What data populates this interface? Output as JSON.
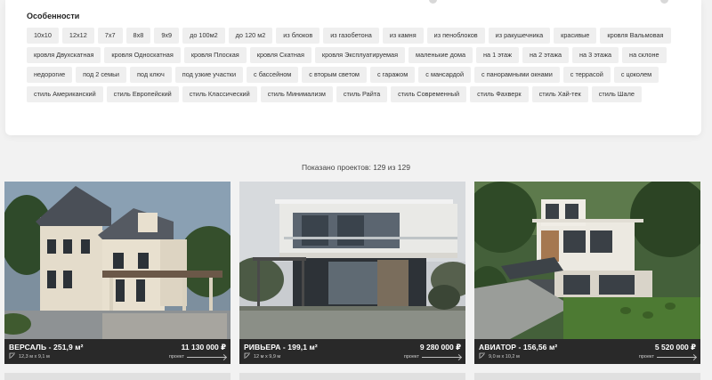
{
  "filters": {
    "title": "Особенности",
    "tags": [
      "10x10",
      "12x12",
      "7x7",
      "8x8",
      "9x9",
      "до 100м2",
      "до 120 м2",
      "из блоков",
      "из газобетона",
      "из камня",
      "из пеноблоков",
      "из ракушечника",
      "красивые",
      "кровля Вальмовая",
      "кровля Двухскатная",
      "кровля Односкатная",
      "кровля Плоская",
      "кровля Скатная",
      "кровля Эксплуатируемая",
      "маленькие дома",
      "на 1 этаж",
      "на 2 этажа",
      "на 3 этажа",
      "на склоне",
      "недорогие",
      "под 2 семьи",
      "под ключ",
      "под узкие участки",
      "с бассейном",
      "с вторым светом",
      "с гаражом",
      "с мансардой",
      "с панорамными окнами",
      "с террасой",
      "с цоколем",
      "стиль Американский",
      "стиль Европейский",
      "стиль Классический",
      "стиль Минимализм",
      "стиль Райта",
      "стиль Современный",
      "стиль Фахверк",
      "стиль Хай-тек",
      "стиль Шале"
    ]
  },
  "results": {
    "shown_text": "Показано проектов: 129 из 129"
  },
  "projects": [
    {
      "name": "ВЕРСАЛЬ - 251,9 м²",
      "size": "12,3 м x 9,1 м",
      "price": "11 130 000 ₽",
      "link_label": "проект"
    },
    {
      "name": "РИВЬЕРА - 199,1 м²",
      "size": "12 м x 9,9 м",
      "price": "9 280 000 ₽",
      "link_label": "проект"
    },
    {
      "name": "АВИАТОР - 156,56 м²",
      "size": "9,0 м x 10,2 м",
      "price": "5 520 000 ₽",
      "link_label": "проект"
    }
  ],
  "colors": {
    "tag_bg": "#efefef",
    "card_footer": "#282828",
    "page_bg": "#f2f2f2"
  }
}
